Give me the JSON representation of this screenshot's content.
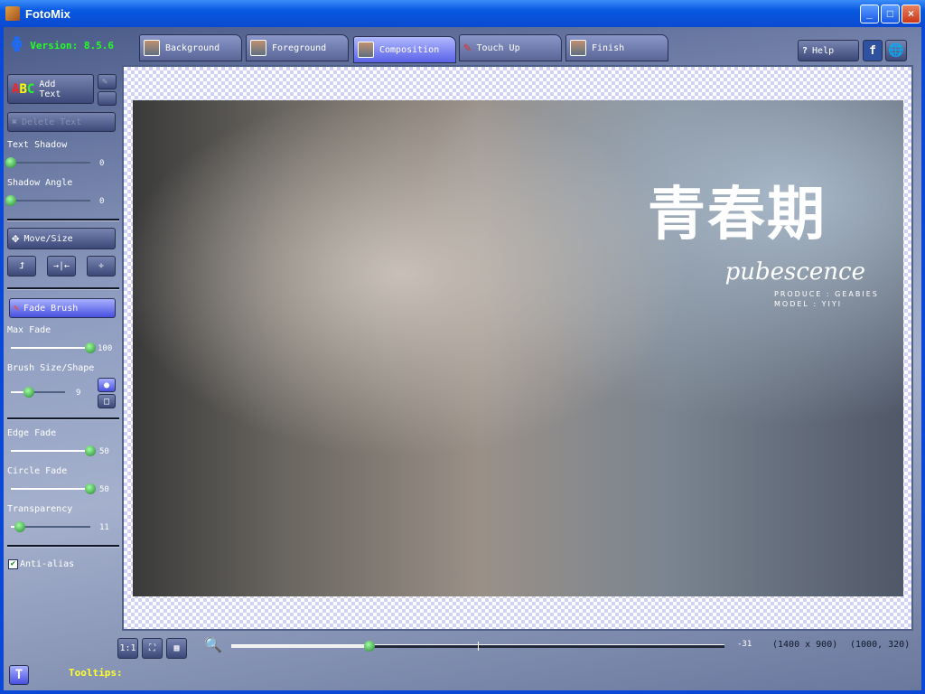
{
  "window": {
    "title": "FotoMix",
    "min": "_",
    "max": "□",
    "close": "×"
  },
  "version": "Version: 8.5.6",
  "tabs": [
    {
      "label": "Background"
    },
    {
      "label": "Foreground"
    },
    {
      "label": "Composition"
    },
    {
      "label": "Touch Up"
    },
    {
      "label": "Finish"
    }
  ],
  "help": "Help",
  "left": {
    "add_text": "Add Text",
    "delete_text": "Delete Text",
    "text_shadow": {
      "label": "Text Shadow",
      "value": "0"
    },
    "shadow_angle": {
      "label": "Shadow Angle",
      "value": "0"
    },
    "move_size": "Move/Size",
    "fade_brush": "Fade Brush",
    "max_fade": {
      "label": "Max Fade",
      "value": "100"
    },
    "brush_size": {
      "label": "Brush Size/Shape",
      "value": "9"
    },
    "edge_fade": {
      "label": "Edge Fade",
      "value": "50"
    },
    "circle_fade": {
      "label": "Circle Fade",
      "value": "50"
    },
    "transparency": {
      "label": "Transparency",
      "value": "11"
    },
    "anti_alias": "Anti-alias"
  },
  "photo": {
    "title": "青春期",
    "subtitle": "pubescence",
    "produce": "PRODUCE : GEABIES",
    "model": "MODEL : YIYI"
  },
  "bottom": {
    "zoom_value": "-31",
    "image_size": "(1400 x 900)",
    "cursor": "(1000, 320)",
    "tooltips": "Tooltips:",
    "one_to_one": "1:1"
  }
}
